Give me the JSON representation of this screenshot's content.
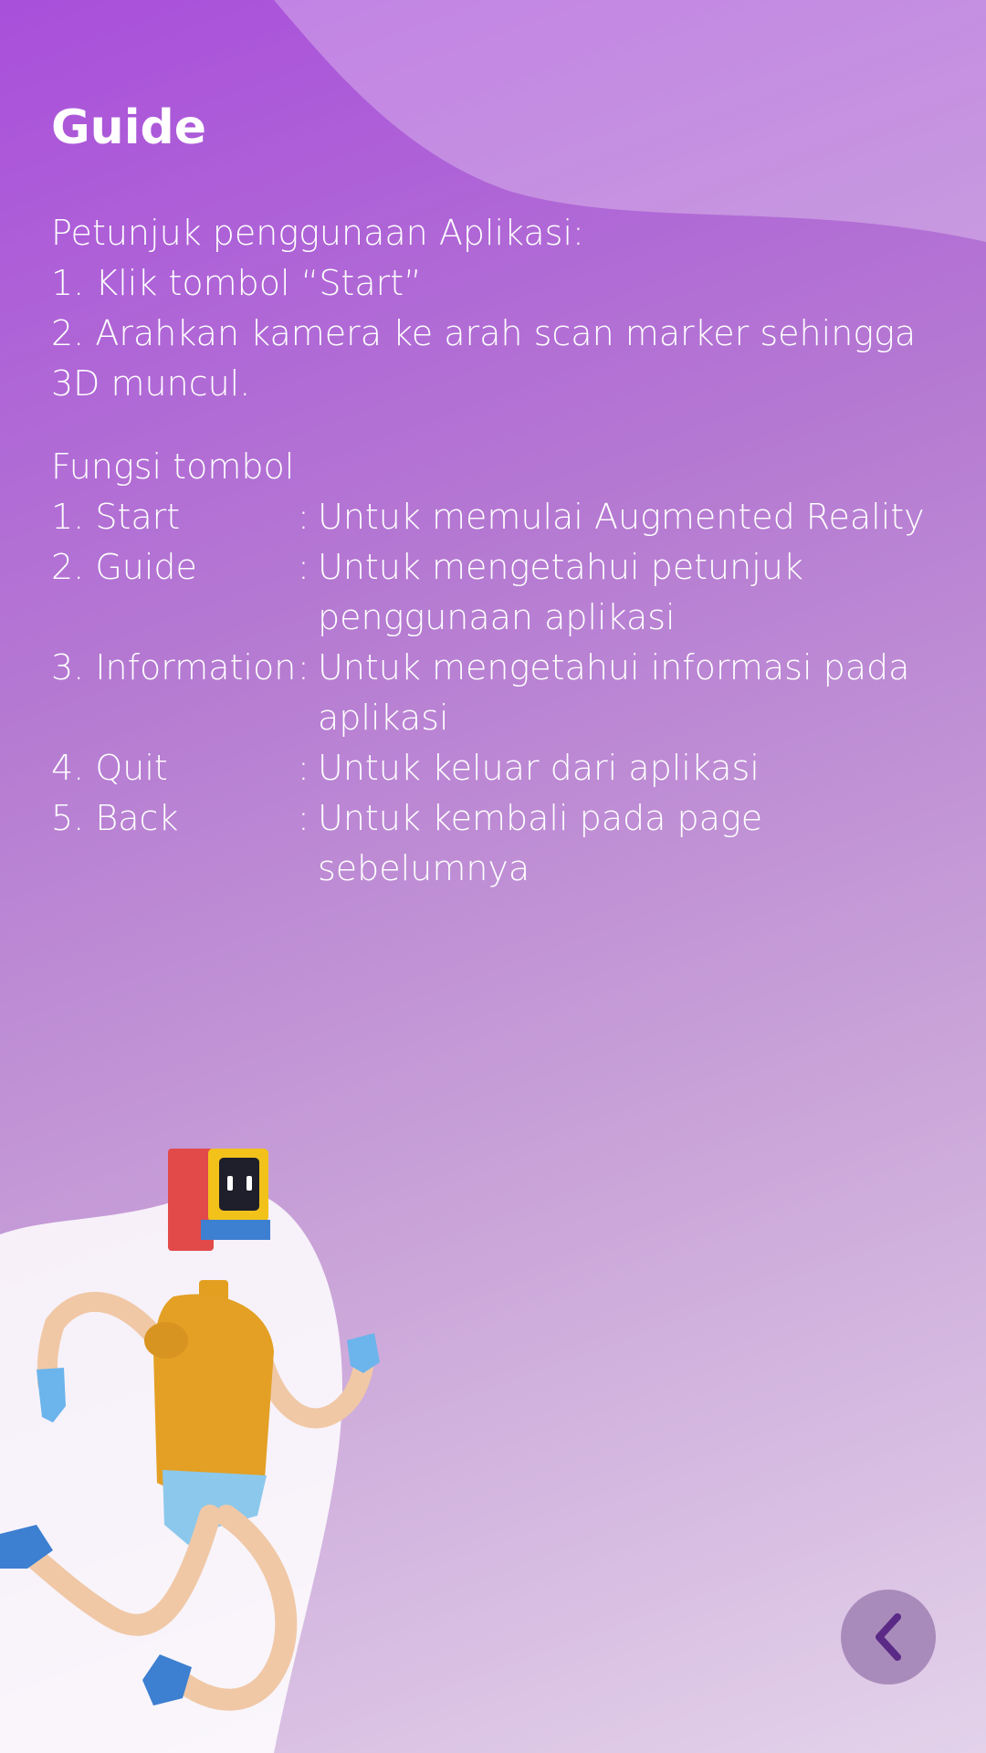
{
  "page": {
    "title": "Guide"
  },
  "instructions": {
    "heading": "Petunjuk penggunaan Aplikasi:",
    "steps": [
      "1.  Klik tombol “Start”",
      "2. Arahkan kamera ke arah scan marker sehingga 3D muncul."
    ]
  },
  "functions": {
    "heading": "Fungsi tombol",
    "items": [
      {
        "name": "1. Start",
        "desc": "Untuk memulai Augmented Reality"
      },
      {
        "name": "2. Guide",
        "desc": "Untuk mengetahui petunjuk penggunaan aplikasi"
      },
      {
        "name": "3. Information",
        "desc": "Untuk mengetahui informasi pada aplikasi"
      },
      {
        "name": "4. Quit",
        "desc": "Untuk keluar dari aplikasi"
      },
      {
        "name": "5. Back",
        "desc": "Untuk kembali pada page sebelumnya"
      }
    ],
    "separator": ":"
  },
  "icons": {
    "back": "chevron-left-icon",
    "illustration": "running-robot-illustration"
  },
  "colors": {
    "gradient_start": "#a94fdb",
    "gradient_end": "#e3d2ea",
    "back_button": "#a98bbb",
    "back_chevron": "#5a2a86",
    "text": "#ffffff"
  }
}
